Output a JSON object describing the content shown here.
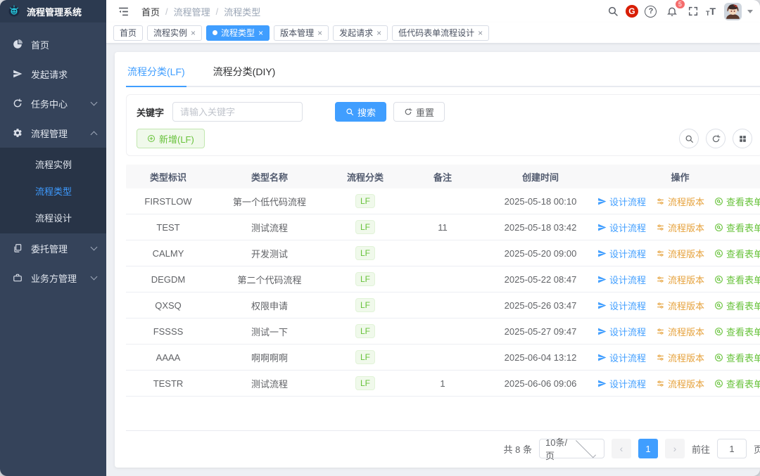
{
  "colors": {
    "accent": "#409eff",
    "success": "#67c23a",
    "warning": "#e6a23c",
    "danger": "#f56c6c",
    "sidebar_bg": "#35435a"
  },
  "app": {
    "title": "流程管理系统"
  },
  "sidebar": {
    "items": [
      {
        "label": "首页"
      },
      {
        "label": "发起请求"
      },
      {
        "label": "任务中心"
      },
      {
        "label": "流程管理"
      },
      {
        "label": "委托管理"
      },
      {
        "label": "业务方管理"
      }
    ],
    "submenu": [
      {
        "label": "流程实例"
      },
      {
        "label": "流程类型"
      },
      {
        "label": "流程设计"
      }
    ]
  },
  "navbar": {
    "breadcrumb": {
      "0": "首页",
      "1": "流程管理",
      "2": "流程类型"
    },
    "separator": "/",
    "bell_badge": "5",
    "gitee_glyph": "G",
    "help_glyph": "?",
    "font_glyph": "T"
  },
  "tags": {
    "close_glyph": "×",
    "items": [
      {
        "label": "首页"
      },
      {
        "label": "流程实例"
      },
      {
        "label": "流程类型"
      },
      {
        "label": "版本管理"
      },
      {
        "label": "发起请求"
      },
      {
        "label": "低代码表单流程设计"
      }
    ]
  },
  "panel_tabs": [
    {
      "label": "流程分类(LF)"
    },
    {
      "label": "流程分类(DIY)"
    }
  ],
  "search": {
    "label": "关键字",
    "placeholder": "请输入关键字",
    "search_btn": "搜索",
    "reset_btn": "重置"
  },
  "toolbar": {
    "add_btn": "新增(LF)"
  },
  "table": {
    "headers": [
      "类型标识",
      "类型名称",
      "流程分类",
      "备注",
      "创建时间",
      "操作"
    ],
    "actions": {
      "design": "设计流程",
      "version": "流程版本",
      "form": "查看表单"
    },
    "rows": [
      {
        "type_id": "FIRSTLOW",
        "type_name": "第一个低代码流程",
        "category": "LF",
        "remark": "",
        "created": "2025-05-18 00:10"
      },
      {
        "type_id": "TEST",
        "type_name": "测试流程",
        "category": "LF",
        "remark": "11",
        "created": "2025-05-18 03:42"
      },
      {
        "type_id": "CALMY",
        "type_name": "开发测试",
        "category": "LF",
        "remark": "",
        "created": "2025-05-20 09:00"
      },
      {
        "type_id": "DEGDM",
        "type_name": "第二个代码流程",
        "category": "LF",
        "remark": "",
        "created": "2025-05-22 08:47"
      },
      {
        "type_id": "QXSQ",
        "type_name": "权限申请",
        "category": "LF",
        "remark": "",
        "created": "2025-05-26 03:47"
      },
      {
        "type_id": "FSSSS",
        "type_name": "测试一下",
        "category": "LF",
        "remark": "",
        "created": "2025-05-27 09:47"
      },
      {
        "type_id": "AAAA",
        "type_name": "啊啊啊啊",
        "category": "LF",
        "remark": "",
        "created": "2025-06-04 13:12"
      },
      {
        "type_id": "TESTR",
        "type_name": "测试流程",
        "category": "LF",
        "remark": "1",
        "created": "2025-06-06 09:06"
      }
    ]
  },
  "pagination": {
    "total": "共 8 条",
    "page_size": "10条/页",
    "prev_glyph": "‹",
    "next_glyph": "›",
    "current_page": "1",
    "goto_label": "前往",
    "goto_value": "1",
    "unit_label": "页"
  }
}
